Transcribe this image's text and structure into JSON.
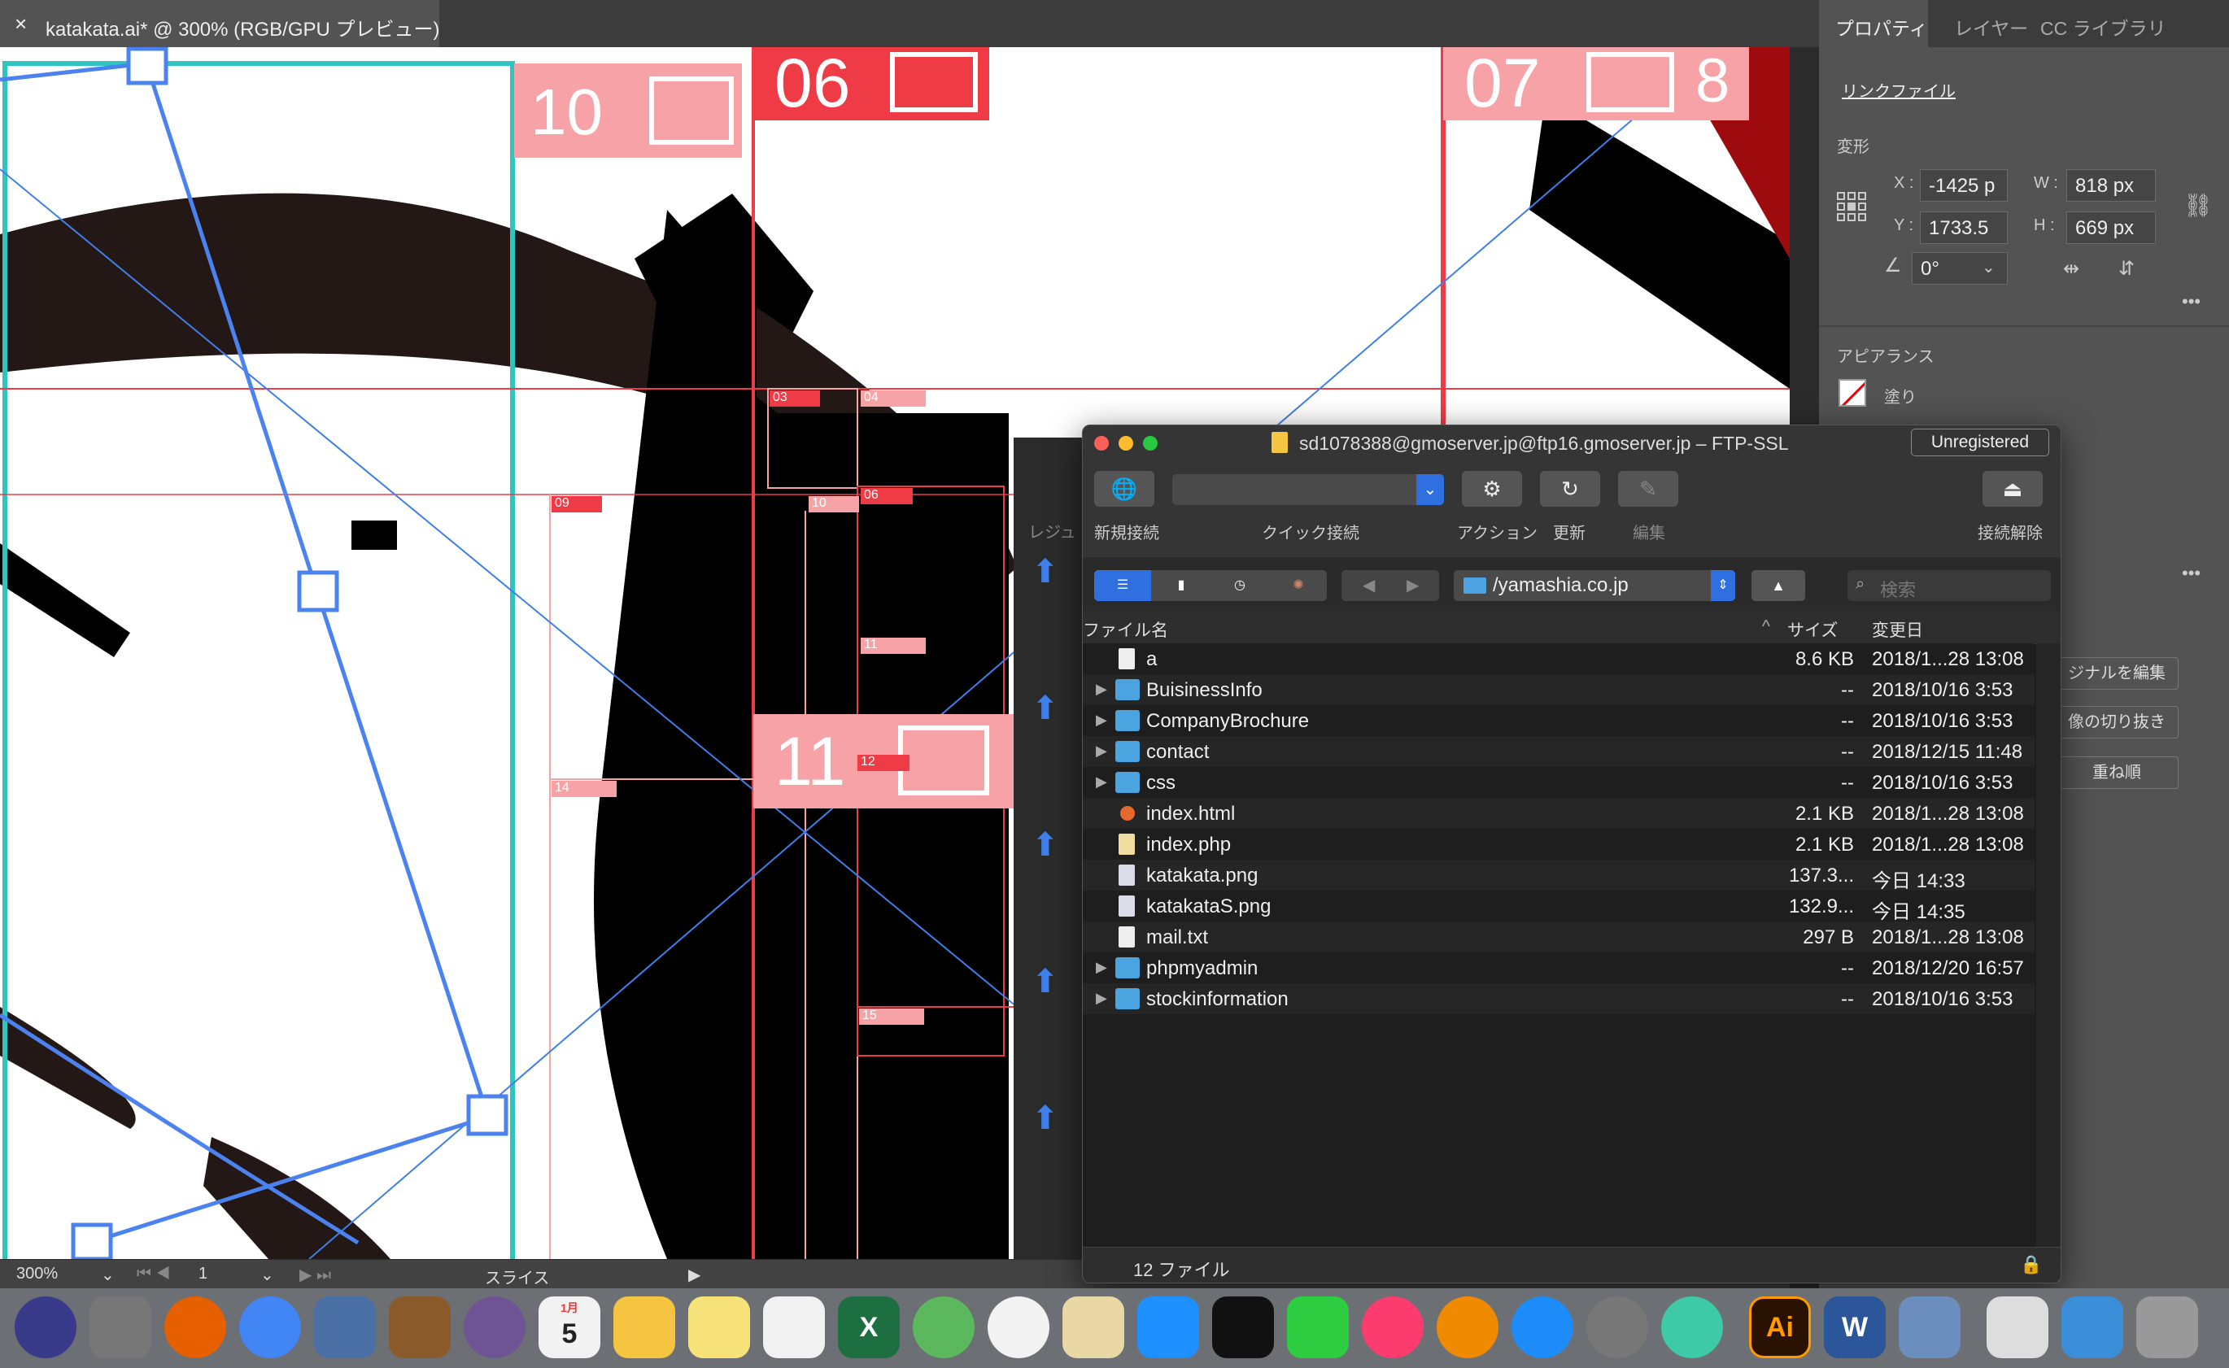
{
  "document_tab": {
    "close": "×",
    "title": "katakata.ai* @ 300% (RGB/GPU プレビュー)"
  },
  "canvas_labels": [
    "10",
    "06",
    "07",
    "03",
    "04",
    "09",
    "10",
    "06",
    "11",
    "11",
    "12",
    "14",
    "15",
    "8"
  ],
  "statusbar": {
    "zoom": "300%",
    "artboard": "1",
    "tool": "スライス"
  },
  "panel": {
    "tabs": [
      "プロパティ",
      "レイヤー",
      "CC ライブラリ"
    ],
    "link_file": "リンクファイル",
    "transform_title": "変形",
    "x_label": "X :",
    "x_value": "-1425 p",
    "y_label": "Y :",
    "y_value": "1733.5",
    "w_label": "W :",
    "w_value": "818 px",
    "h_label": "H :",
    "h_value": "669 px",
    "angle_value": "0°",
    "appearance_title": "アピアランス",
    "fill_label": "塗り",
    "btn_edit_original": "ジナルを編集",
    "btn_crop": "像の切り抜き",
    "btn_arrange": "重ね順",
    "more": "•••"
  },
  "ftp": {
    "title": "sd1078388@gmoserver.jp@ftp16.gmoserver.jp – FTP-SSL",
    "badge": "Unregistered",
    "toolbar": {
      "new_connection": "新規接続",
      "quick_connect": "クイック接続",
      "action": "アクション",
      "refresh": "更新",
      "edit": "編集",
      "disconnect": "接続解除"
    },
    "path": "/yamashia.co.jp",
    "search_placeholder": "検索",
    "columns": {
      "name": "ファイル名",
      "size": "サイズ",
      "date": "変更日"
    },
    "files": [
      {
        "name": "a",
        "size": "8.6 KB",
        "date": "2018/1...28 13:08",
        "type": "file"
      },
      {
        "name": "BuisinessInfo",
        "size": "--",
        "date": "2018/10/16 3:53",
        "type": "folder"
      },
      {
        "name": "CompanyBrochure",
        "size": "--",
        "date": "2018/10/16 3:53",
        "type": "folder"
      },
      {
        "name": "contact",
        "size": "--",
        "date": "2018/12/15 11:48",
        "type": "folder"
      },
      {
        "name": "css",
        "size": "--",
        "date": "2018/10/16 3:53",
        "type": "folder"
      },
      {
        "name": "index.html",
        "size": "2.1 KB",
        "date": "2018/1...28 13:08",
        "type": "html"
      },
      {
        "name": "index.php",
        "size": "2.1 KB",
        "date": "2018/1...28 13:08",
        "type": "php"
      },
      {
        "name": "katakata.png",
        "size": "137.3...",
        "date": "今日 14:33",
        "type": "image"
      },
      {
        "name": "katakataS.png",
        "size": "132.9...",
        "date": "今日 14:35",
        "type": "image"
      },
      {
        "name": "mail.txt",
        "size": "297 B",
        "date": "2018/1...28 13:08",
        "type": "file"
      },
      {
        "name": "phpmyadmin",
        "size": "--",
        "date": "2018/12/20 16:57",
        "type": "folder"
      },
      {
        "name": "stockinformation",
        "size": "--",
        "date": "2018/10/16 3:53",
        "type": "folder"
      }
    ],
    "footer": "12 ファイル"
  },
  "left_strip_label": "レジュ",
  "dock": {
    "items": [
      "Siri",
      "Launchpad",
      "Firefox",
      "Chrome",
      "Preview",
      "Notefile",
      "GitHub",
      "Calendar",
      "Cyberduck",
      "Notes",
      "Reminders",
      "Excel",
      "Maps",
      "Photos",
      "TextEdit",
      "Messages",
      "Terminal",
      "FaceTime",
      "iTunes",
      "iBooks",
      "App Store",
      "System Preferences",
      "Atom",
      "Illustrator",
      "Word",
      "Preview2",
      "HTML File",
      "Folder",
      "Trash"
    ],
    "calendar_month": "1月",
    "calendar_day": "5",
    "ai_label": "Ai",
    "word_label": "W",
    "excel_label": "X"
  },
  "colors": {
    "guide_red": "#ee3b45",
    "slice_pink": "#f7a2a6",
    "teal": "#2ec4c0",
    "blue_sel": "#3f7fe8",
    "ink": "#231815"
  }
}
